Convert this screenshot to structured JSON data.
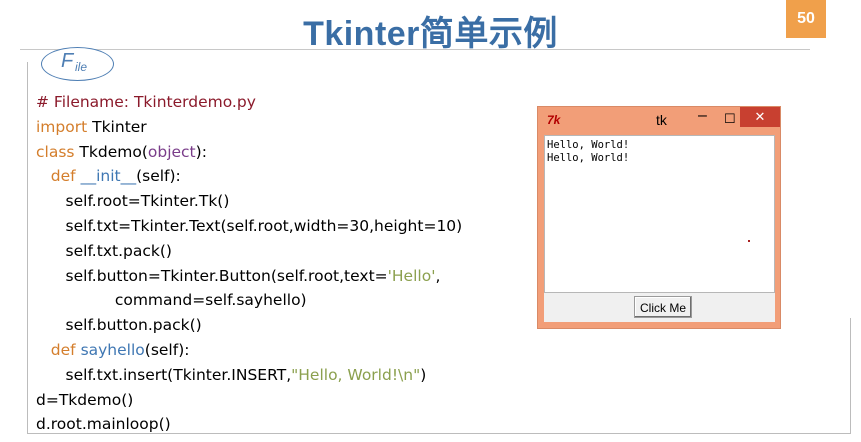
{
  "slide": {
    "title": "Tkinter简单示例",
    "page_number": "50",
    "badge": {
      "big": "F",
      "small": "ile"
    }
  },
  "code": {
    "lines": [
      [
        {
          "t": "# Filename: Tkinterdemo.py",
          "c": "comment"
        }
      ],
      [
        {
          "t": "import",
          "c": "kw"
        },
        {
          "t": " Tkinter",
          "c": ""
        }
      ],
      [
        {
          "t": "class",
          "c": "kw"
        },
        {
          "t": " Tkdemo(",
          "c": ""
        },
        {
          "t": "object",
          "c": "builtin"
        },
        {
          "t": "):",
          "c": ""
        }
      ],
      [
        {
          "t": "   ",
          "c": ""
        },
        {
          "t": "def",
          "c": "kw"
        },
        {
          "t": " ",
          "c": ""
        },
        {
          "t": "__init__",
          "c": "fn"
        },
        {
          "t": "(self):",
          "c": ""
        }
      ],
      [
        {
          "t": "      self.root=Tkinter.Tk()",
          "c": ""
        }
      ],
      [
        {
          "t": "      self.txt=Tkinter.Text(self.root,width=30,height=10)",
          "c": ""
        }
      ],
      [
        {
          "t": "      self.txt.pack()",
          "c": ""
        }
      ],
      [
        {
          "t": "      self.button=Tkinter.Button(self.root,text=",
          "c": ""
        },
        {
          "t": "'Hello'",
          "c": "str"
        },
        {
          "t": ",",
          "c": ""
        }
      ],
      [
        {
          "t": "                command=self.sayhello)",
          "c": ""
        }
      ],
      [
        {
          "t": "      self.button.pack()",
          "c": ""
        }
      ],
      [
        {
          "t": "   ",
          "c": ""
        },
        {
          "t": "def",
          "c": "kw"
        },
        {
          "t": " ",
          "c": ""
        },
        {
          "t": "sayhello",
          "c": "fn"
        },
        {
          "t": "(self):",
          "c": ""
        }
      ],
      [
        {
          "t": "      self.txt.insert(Tkinter.INSERT,",
          "c": ""
        },
        {
          "t": "\"Hello, World!\\n\"",
          "c": "str"
        },
        {
          "t": ")",
          "c": ""
        }
      ],
      [
        {
          "t": "d=Tkdemo()",
          "c": ""
        }
      ],
      [
        {
          "t": "d.root.mainloop()",
          "c": ""
        }
      ]
    ]
  },
  "tk_window": {
    "logo": "7k",
    "title": "tk",
    "minimize": "–",
    "maximize": "☐",
    "close": "✕",
    "text_lines": [
      "Hello, World!",
      "Hello, World!"
    ],
    "button_label": "Click Me"
  },
  "colors": {
    "title": "#3a6ea5",
    "page_badge": "#f0a04b",
    "comment": "#8b1a2b",
    "keyword": "#d47e2c",
    "builtin": "#7a3d8a",
    "function": "#3f77b3",
    "string": "#8ba04e",
    "tk_frame": "#f29e78",
    "tk_close": "#c84030"
  }
}
